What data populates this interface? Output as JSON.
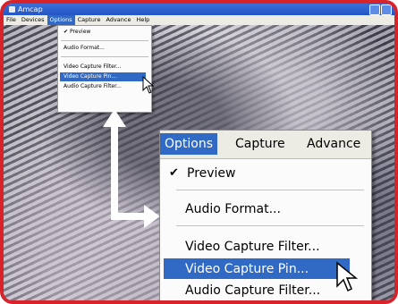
{
  "window": {
    "title": "Amcap"
  },
  "menubar": [
    "File",
    "Devices",
    "Options",
    "Capture",
    "Advance",
    "Help"
  ],
  "options_menu": {
    "items": [
      {
        "label": "Preview",
        "checked": true
      },
      {
        "label": "Audio Format..."
      },
      {
        "label": "Video Capture Filter..."
      },
      {
        "label": "Video Capture Pin...",
        "highlighted": true
      },
      {
        "label": "Audio Capture Filter..."
      }
    ]
  },
  "zoom_menu": {
    "headers": [
      "Options",
      "Capture",
      "Advance"
    ],
    "check_mark": "✔",
    "items": [
      {
        "label": "Preview",
        "checked": true
      },
      {
        "label": "Audio Format..."
      },
      {
        "label": "Video Capture Filter..."
      },
      {
        "label": "Video Capture Pin...",
        "highlighted": true
      },
      {
        "label": "Audio Capture Filter..."
      }
    ]
  },
  "colors": {
    "frame": "#d8232a",
    "selection": "#316ac5",
    "titlebar": "#2456c6"
  }
}
